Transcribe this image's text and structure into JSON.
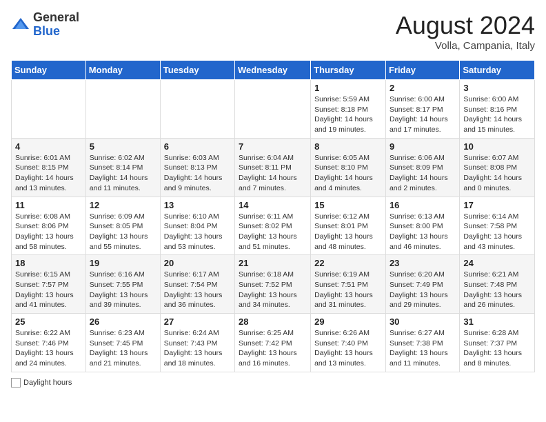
{
  "header": {
    "logo_general": "General",
    "logo_blue": "Blue",
    "title": "August 2024",
    "subtitle": "Volla, Campania, Italy"
  },
  "days_of_week": [
    "Sunday",
    "Monday",
    "Tuesday",
    "Wednesday",
    "Thursday",
    "Friday",
    "Saturday"
  ],
  "weeks": [
    {
      "row_bg": "#fff",
      "cells": [
        {
          "day": "",
          "info": ""
        },
        {
          "day": "",
          "info": ""
        },
        {
          "day": "",
          "info": ""
        },
        {
          "day": "",
          "info": ""
        },
        {
          "day": "1",
          "info": "Sunrise: 5:59 AM\nSunset: 8:18 PM\nDaylight: 14 hours and 19 minutes."
        },
        {
          "day": "2",
          "info": "Sunrise: 6:00 AM\nSunset: 8:17 PM\nDaylight: 14 hours and 17 minutes."
        },
        {
          "day": "3",
          "info": "Sunrise: 6:00 AM\nSunset: 8:16 PM\nDaylight: 14 hours and 15 minutes."
        }
      ]
    },
    {
      "row_bg": "#f5f5f5",
      "cells": [
        {
          "day": "4",
          "info": "Sunrise: 6:01 AM\nSunset: 8:15 PM\nDaylight: 14 hours and 13 minutes."
        },
        {
          "day": "5",
          "info": "Sunrise: 6:02 AM\nSunset: 8:14 PM\nDaylight: 14 hours and 11 minutes."
        },
        {
          "day": "6",
          "info": "Sunrise: 6:03 AM\nSunset: 8:13 PM\nDaylight: 14 hours and 9 minutes."
        },
        {
          "day": "7",
          "info": "Sunrise: 6:04 AM\nSunset: 8:11 PM\nDaylight: 14 hours and 7 minutes."
        },
        {
          "day": "8",
          "info": "Sunrise: 6:05 AM\nSunset: 8:10 PM\nDaylight: 14 hours and 4 minutes."
        },
        {
          "day": "9",
          "info": "Sunrise: 6:06 AM\nSunset: 8:09 PM\nDaylight: 14 hours and 2 minutes."
        },
        {
          "day": "10",
          "info": "Sunrise: 6:07 AM\nSunset: 8:08 PM\nDaylight: 14 hours and 0 minutes."
        }
      ]
    },
    {
      "row_bg": "#fff",
      "cells": [
        {
          "day": "11",
          "info": "Sunrise: 6:08 AM\nSunset: 8:06 PM\nDaylight: 13 hours and 58 minutes."
        },
        {
          "day": "12",
          "info": "Sunrise: 6:09 AM\nSunset: 8:05 PM\nDaylight: 13 hours and 55 minutes."
        },
        {
          "day": "13",
          "info": "Sunrise: 6:10 AM\nSunset: 8:04 PM\nDaylight: 13 hours and 53 minutes."
        },
        {
          "day": "14",
          "info": "Sunrise: 6:11 AM\nSunset: 8:02 PM\nDaylight: 13 hours and 51 minutes."
        },
        {
          "day": "15",
          "info": "Sunrise: 6:12 AM\nSunset: 8:01 PM\nDaylight: 13 hours and 48 minutes."
        },
        {
          "day": "16",
          "info": "Sunrise: 6:13 AM\nSunset: 8:00 PM\nDaylight: 13 hours and 46 minutes."
        },
        {
          "day": "17",
          "info": "Sunrise: 6:14 AM\nSunset: 7:58 PM\nDaylight: 13 hours and 43 minutes."
        }
      ]
    },
    {
      "row_bg": "#f5f5f5",
      "cells": [
        {
          "day": "18",
          "info": "Sunrise: 6:15 AM\nSunset: 7:57 PM\nDaylight: 13 hours and 41 minutes."
        },
        {
          "day": "19",
          "info": "Sunrise: 6:16 AM\nSunset: 7:55 PM\nDaylight: 13 hours and 39 minutes."
        },
        {
          "day": "20",
          "info": "Sunrise: 6:17 AM\nSunset: 7:54 PM\nDaylight: 13 hours and 36 minutes."
        },
        {
          "day": "21",
          "info": "Sunrise: 6:18 AM\nSunset: 7:52 PM\nDaylight: 13 hours and 34 minutes."
        },
        {
          "day": "22",
          "info": "Sunrise: 6:19 AM\nSunset: 7:51 PM\nDaylight: 13 hours and 31 minutes."
        },
        {
          "day": "23",
          "info": "Sunrise: 6:20 AM\nSunset: 7:49 PM\nDaylight: 13 hours and 29 minutes."
        },
        {
          "day": "24",
          "info": "Sunrise: 6:21 AM\nSunset: 7:48 PM\nDaylight: 13 hours and 26 minutes."
        }
      ]
    },
    {
      "row_bg": "#fff",
      "cells": [
        {
          "day": "25",
          "info": "Sunrise: 6:22 AM\nSunset: 7:46 PM\nDaylight: 13 hours and 24 minutes."
        },
        {
          "day": "26",
          "info": "Sunrise: 6:23 AM\nSunset: 7:45 PM\nDaylight: 13 hours and 21 minutes."
        },
        {
          "day": "27",
          "info": "Sunrise: 6:24 AM\nSunset: 7:43 PM\nDaylight: 13 hours and 18 minutes."
        },
        {
          "day": "28",
          "info": "Sunrise: 6:25 AM\nSunset: 7:42 PM\nDaylight: 13 hours and 16 minutes."
        },
        {
          "day": "29",
          "info": "Sunrise: 6:26 AM\nSunset: 7:40 PM\nDaylight: 13 hours and 13 minutes."
        },
        {
          "day": "30",
          "info": "Sunrise: 6:27 AM\nSunset: 7:38 PM\nDaylight: 13 hours and 11 minutes."
        },
        {
          "day": "31",
          "info": "Sunrise: 6:28 AM\nSunset: 7:37 PM\nDaylight: 13 hours and 8 minutes."
        }
      ]
    }
  ],
  "legend": {
    "daylight_label": "Daylight hours"
  }
}
